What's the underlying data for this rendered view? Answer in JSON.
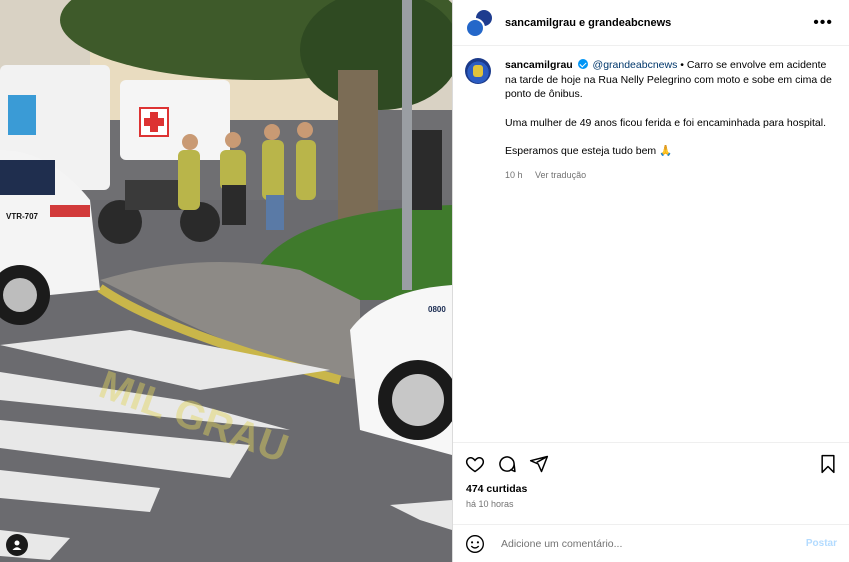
{
  "post": {
    "header_title": "sancamilgrau e grandeabcnews",
    "author": "sancamilgrau",
    "mention": "@grandeabcnews",
    "caption_line1": " • Carro se envolve em acidente na tarde de hoje na Rua Nelly Pelegrino com moto e sobe em cima de ponto de ônibus.",
    "caption_line2": "Uma mulher de 49 anos ficou ferida e foi encaminhada para hospital.",
    "caption_line3": "Esperamos que esteja tudo bem 🙏",
    "time": "10 h",
    "translate": "Ver tradução",
    "likes": "474 curtidas",
    "ago": "há 10 horas"
  },
  "photo": {
    "watermark": "MIL GRAU",
    "vehicle_plate": "VTR-707",
    "car_text": "0800"
  },
  "comment": {
    "placeholder": "Adicione um comentário...",
    "post_label": "Postar"
  },
  "icons": {
    "more": "more-options-icon",
    "like": "heart-icon",
    "comment": "comment-icon",
    "share": "share-icon",
    "save": "bookmark-icon",
    "emoji": "emoji-icon",
    "tag": "user-tag-icon"
  },
  "colors": {
    "verified": "#0095f6",
    "mention": "#00376b",
    "post_disabled": "#b3dbff"
  }
}
